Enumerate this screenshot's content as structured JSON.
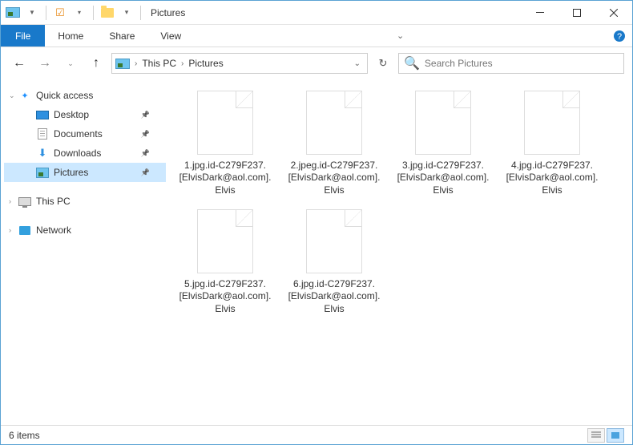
{
  "titlebar": {
    "title": "Pictures"
  },
  "ribbon": {
    "file": "File",
    "tabs": [
      "Home",
      "Share",
      "View"
    ]
  },
  "breadcrumb": {
    "items": [
      "This PC",
      "Pictures"
    ]
  },
  "search": {
    "placeholder": "Search Pictures"
  },
  "sidebar": {
    "quick_access": "Quick access",
    "desktop": "Desktop",
    "documents": "Documents",
    "downloads": "Downloads",
    "pictures": "Pictures",
    "this_pc": "This PC",
    "network": "Network"
  },
  "files": [
    {
      "name": "1.jpg.id-C279F237.[ElvisDark@aol.com].Elvis"
    },
    {
      "name": "2.jpeg.id-C279F237.[ElvisDark@aol.com].Elvis"
    },
    {
      "name": "3.jpg.id-C279F237.[ElvisDark@aol.com].Elvis"
    },
    {
      "name": "4.jpg.id-C279F237.[ElvisDark@aol.com].Elvis"
    },
    {
      "name": "5.jpg.id-C279F237.[ElvisDark@aol.com].Elvis"
    },
    {
      "name": "6.jpg.id-C279F237.[ElvisDark@aol.com].Elvis"
    }
  ],
  "statusbar": {
    "count": "6 items"
  }
}
